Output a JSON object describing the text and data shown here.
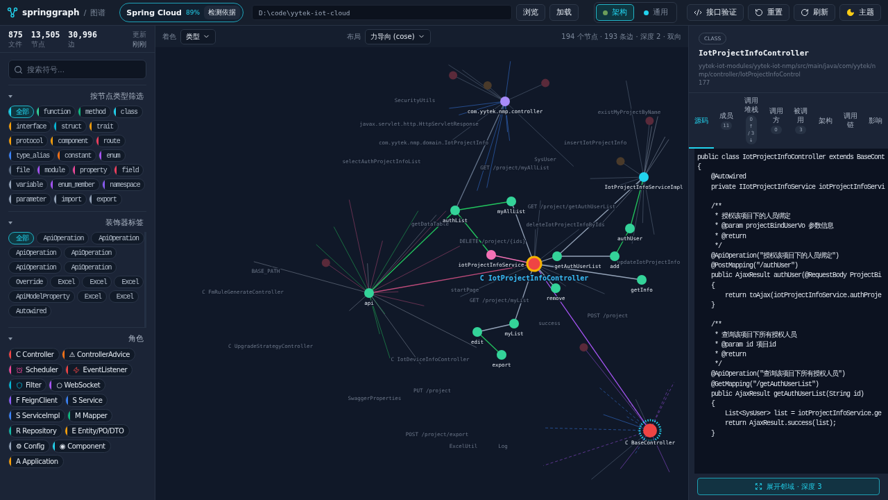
{
  "app": {
    "name": "springgraph",
    "separator": "/",
    "section": "图谱"
  },
  "framework": {
    "name": "Spring Cloud",
    "confidence": "89%",
    "button": "检测依据"
  },
  "path_field": {
    "value": "D:\\code\\yytek-iot-cloud"
  },
  "path_buttons": [
    "浏览",
    "加载"
  ],
  "modes": [
    {
      "label": "架构",
      "selected": true
    },
    {
      "label": "通用",
      "selected": false
    }
  ],
  "actions": [
    {
      "label": "接口验证"
    },
    {
      "label": "重置"
    },
    {
      "label": "刷新"
    },
    {
      "label": "主题"
    }
  ],
  "stats": [
    {
      "value": "875",
      "label": "文件"
    },
    {
      "value": "13,505",
      "label": "节点"
    },
    {
      "value": "30,996",
      "label": "边"
    }
  ],
  "updated": {
    "label": "更新",
    "value": "刚刚"
  },
  "search": {
    "placeholder": "搜索符号..."
  },
  "sections": [
    {
      "title": "按节点类型筛选",
      "expanded": true,
      "scroll": false,
      "chips": [
        {
          "kind": "code",
          "label": "全部",
          "selected": true,
          "color": "#22d3ee"
        },
        {
          "kind": "code",
          "label": "function",
          "selected": false,
          "color": "#34d399"
        },
        {
          "kind": "code",
          "label": "method",
          "selected": false,
          "color": "#10b981"
        },
        {
          "kind": "code",
          "label": "class",
          "selected": false,
          "color": "#22d3ee"
        },
        {
          "kind": "code",
          "label": "interface",
          "selected": false,
          "color": "#f59e0b"
        },
        {
          "kind": "code",
          "label": "struct",
          "selected": false,
          "color": "#06b6d4"
        },
        {
          "kind": "code",
          "label": "trait",
          "selected": false,
          "color": "#f59e0b"
        },
        {
          "kind": "code",
          "label": "protocol",
          "selected": false,
          "color": "#f59e0b"
        },
        {
          "kind": "code",
          "label": "component",
          "selected": false,
          "color": "#f59e0b"
        },
        {
          "kind": "code",
          "label": "route",
          "selected": false,
          "color": "#f43f5e"
        },
        {
          "kind": "code",
          "label": "type_alias",
          "selected": false,
          "color": "#3b82f6"
        },
        {
          "kind": "code",
          "label": "constant",
          "selected": false,
          "color": "#f97316"
        },
        {
          "kind": "code",
          "label": "enum",
          "selected": false,
          "color": "#a855f7"
        },
        {
          "kind": "code",
          "label": "file",
          "selected": false,
          "color": "#64748b"
        },
        {
          "kind": "code",
          "label": "module",
          "selected": false,
          "color": "#a855f7"
        },
        {
          "kind": "code",
          "label": "property",
          "selected": false,
          "color": "#ec4899"
        },
        {
          "kind": "code",
          "label": "field",
          "selected": false,
          "color": "#f43f5e"
        },
        {
          "kind": "code",
          "label": "variable",
          "selected": false,
          "color": "#94a3b8"
        },
        {
          "kind": "code",
          "label": "enum_member",
          "selected": false,
          "color": "#a855f7"
        },
        {
          "kind": "code",
          "label": "namespace",
          "selected": false,
          "color": "#8b5cf6"
        },
        {
          "kind": "code",
          "label": "parameter",
          "selected": false,
          "color": "#94a3b8"
        },
        {
          "kind": "code",
          "label": "import",
          "selected": false,
          "color": "#94a3b8"
        },
        {
          "kind": "code",
          "label": "export",
          "selected": false,
          "color": "#94a3b8"
        }
      ]
    },
    {
      "title": "装饰器标签",
      "expanded": true,
      "scroll": true,
      "chips": [
        {
          "kind": "code",
          "label": "全部",
          "selected": true
        },
        {
          "kind": "code",
          "label": "ApiOperation",
          "selected": false
        },
        {
          "kind": "code",
          "label": "ApiOperation",
          "selected": false
        },
        {
          "kind": "code",
          "label": "ApiOperation",
          "selected": false
        },
        {
          "kind": "code",
          "label": "ApiOperation",
          "selected": false
        },
        {
          "kind": "code",
          "label": "ApiOperation",
          "selected": false
        },
        {
          "kind": "code",
          "label": "ApiOperation",
          "selected": false
        },
        {
          "kind": "code",
          "label": "Override",
          "selected": false
        },
        {
          "kind": "code",
          "label": "Excel",
          "selected": false
        },
        {
          "kind": "code",
          "label": "Excel",
          "selected": false
        },
        {
          "kind": "code",
          "label": "Excel",
          "selected": false
        },
        {
          "kind": "code",
          "label": "ApiModelProperty",
          "selected": false
        },
        {
          "kind": "code",
          "label": "Excel",
          "selected": false
        },
        {
          "kind": "code",
          "label": "Excel",
          "selected": false
        },
        {
          "kind": "code",
          "label": "Autowired",
          "selected": false
        }
      ]
    },
    {
      "title": "角色",
      "expanded": true,
      "scroll": false,
      "chips": [
        {
          "kind": "role",
          "label": "C Controller",
          "selected": false,
          "color": "#ef4444"
        },
        {
          "kind": "role",
          "label": "⚠ ControllerAdvice",
          "selected": false,
          "color": "#f97316"
        },
        {
          "kind": "role-icon",
          "label": "Scheduler",
          "selected": false,
          "color": "#ec4899"
        },
        {
          "kind": "role-icon",
          "label": "EventListener",
          "selected": false,
          "color": "#ef4444"
        },
        {
          "kind": "role-icon",
          "label": "Filter",
          "selected": false,
          "color": "#06b6d4"
        },
        {
          "kind": "role",
          "label": "○ WebSocket",
          "selected": false,
          "color": "#a855f7"
        },
        {
          "kind": "role",
          "label": "F FeignClient",
          "selected": false,
          "color": "#8b5cf6"
        },
        {
          "kind": "role",
          "label": "S Service",
          "selected": false,
          "color": "#3b82f6"
        },
        {
          "kind": "role",
          "label": "S ServiceImpl",
          "selected": false,
          "color": "#3b82f6"
        },
        {
          "kind": "role",
          "label": "M Mapper",
          "selected": false,
          "color": "#10b981"
        },
        {
          "kind": "role",
          "label": "R Repository",
          "selected": false,
          "color": "#14b8a6"
        },
        {
          "kind": "role",
          "label": "E Entity/PO/DTO",
          "selected": false,
          "color": "#f59e0b"
        },
        {
          "kind": "role",
          "label": "⚙ Config",
          "selected": false,
          "color": "#94a3b8"
        },
        {
          "kind": "role",
          "label": "◉ Component",
          "selected": false,
          "color": "#22d3ee"
        },
        {
          "kind": "role",
          "label": "A Application",
          "selected": false,
          "color": "#f59e0b"
        }
      ]
    }
  ],
  "graph": {
    "coloring": {
      "label": "着色",
      "value": "类型"
    },
    "layout": {
      "label": "布局",
      "value": "力导向 (cose)"
    },
    "summary": "194 个节点 · 193 条边 · 深度 2 · 双向",
    "nodes": [
      {
        "label": "com.yytek.nmp.controller",
        "color": "#a78bfa",
        "selected": false
      },
      {
        "label": "IotProjectInfoServiceImpl",
        "color": "#22d3ee",
        "selected": false
      },
      {
        "label": "myAllList",
        "color": "#34d399",
        "selected": false
      },
      {
        "label": "authList",
        "color": "#34d399",
        "selected": false
      },
      {
        "label": "authUser",
        "color": "#34d399",
        "selected": false
      },
      {
        "label": "iotProjectInfoService",
        "color": "#f472b6",
        "selected": false
      },
      {
        "label": "getAuthUserList",
        "color": "#34d399",
        "selected": false
      },
      {
        "label": "add",
        "color": "#34d399",
        "selected": false
      },
      {
        "label": "C IotProjectInfoController",
        "color": "#ef4444",
        "selected": true
      },
      {
        "label": "getInfo",
        "color": "#34d399",
        "selected": false
      },
      {
        "label": "remove",
        "color": "#34d399",
        "selected": false
      },
      {
        "label": "api",
        "color": "#34d399",
        "selected": false
      },
      {
        "label": "myList",
        "color": "#34d399",
        "selected": false
      },
      {
        "label": "edit",
        "color": "#34d399",
        "selected": false
      },
      {
        "label": "export",
        "color": "#34d399",
        "selected": false
      },
      {
        "label": "C BaseController",
        "color": "#ef4444",
        "selected": false
      }
    ],
    "faint_labels": [
      "SecurityUtils",
      "existMyProjectByName",
      "javax.servlet.http.HttpServletResponse",
      "com.yytek.nmp.domain.IotProjectInfo",
      "insertIotProjectInfo",
      "SysUser",
      "selectAuthProjectInfoList",
      "GET /project/myAllList",
      "GET /project/getAuthUserList",
      "getDataTable",
      "deleteIotProjectInfoByIds",
      "DELETE /project/{ids}",
      "updateIotProjectInfo",
      "BASE_PATH",
      "startPage",
      "C FmRuleGenerateController",
      "GET /project/myList",
      "POST /project",
      "success",
      "C UpgradeStrategyController",
      "C IotDeviceInfoController",
      "PUT /project",
      "SwaggerProperties",
      "POST /project/export",
      "ExcelUtil",
      "Log"
    ]
  },
  "detail": {
    "badge": "CLASS",
    "title": "IotProjectInfoController",
    "path": "yytek-iot-modules/yytek-iot-nmp/src/main/java/com/yytek/nmp/controller/IotProjectInfoControl",
    "line": "177",
    "tabs": [
      {
        "label": "源码",
        "selected": true
      },
      {
        "label": "成员",
        "count": "11",
        "selected": false
      },
      {
        "label": "调用堆栈",
        "count": "0↑ / 3↓",
        "selected": false
      },
      {
        "label": "调用方",
        "count": "0",
        "selected": false
      },
      {
        "label": "被调用",
        "count": "3",
        "selected": false
      },
      {
        "label": "架构",
        "selected": false
      },
      {
        "label": "调用链",
        "selected": false
      },
      {
        "label": "影响",
        "selected": false
      }
    ],
    "code": "public class IotProjectInfoController extends BaseCont\n{\n    @Autowired\n    private IIotProjectInfoService iotProjectInfoServi\n\n    /**\n     * 授权该项目下的人员绑定\n     * @param projectBindUserVo 参数信息\n     * @return\n     */\n    @ApiOperation(\"授权该项目下的人员绑定\")\n    @PostMapping(\"/authUser\")\n    public AjaxResult authUser(@RequestBody ProjectBi\n    {\n        return toAjax(iotProjectInfoService.authProje\n    }\n\n    /**\n     * 查询该项目下所有授权人员\n     * @param id 项目id\n     * @return\n     */\n    @ApiOperation(\"查询该项目下所有授权人员\")\n    @GetMapping(\"/getAuthUserList\")\n    public AjaxResult getAuthUserList(String id)\n    {\n        List<SysUser> list = iotProjectInfoService.ge\n        return AjaxResult.success(list);\n    }",
    "expand_button": "展开邻域 · 深度 3"
  }
}
